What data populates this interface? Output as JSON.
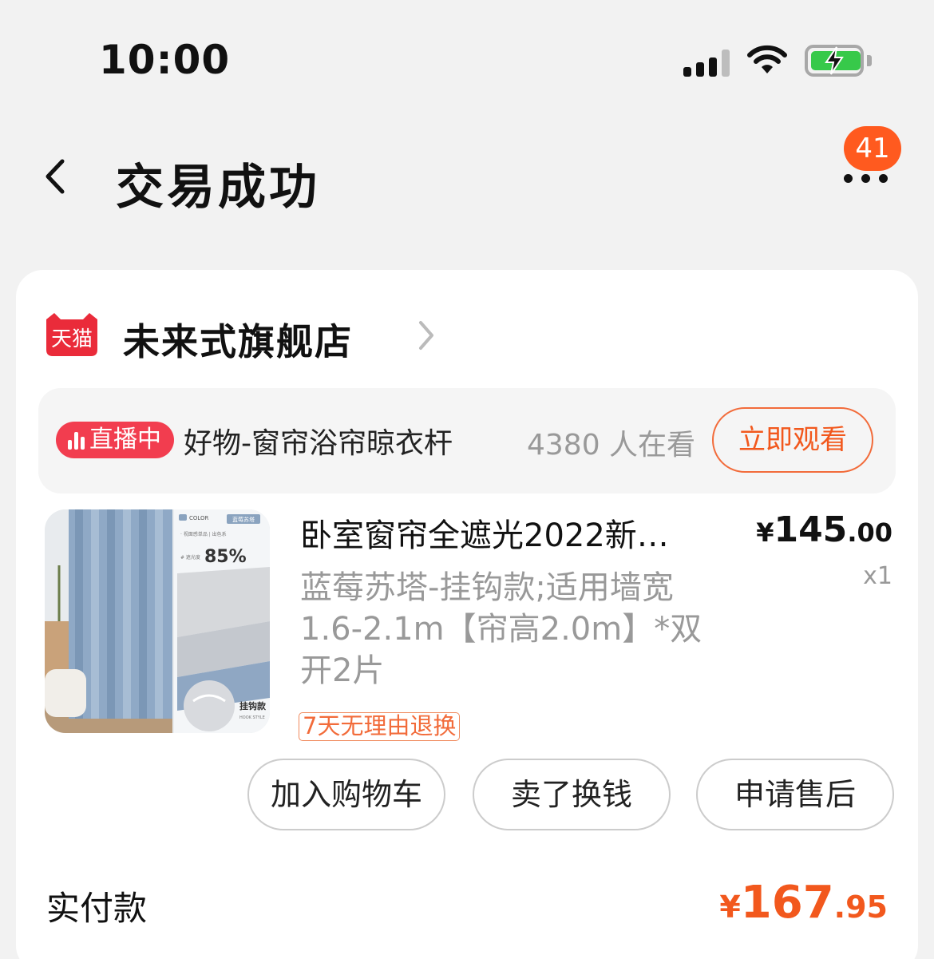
{
  "status_bar": {
    "time": "10:00"
  },
  "header": {
    "title": "交易成功",
    "message_badge": "41"
  },
  "store": {
    "logo_text": "天猫",
    "name": "未来式旗舰店"
  },
  "live": {
    "tag": "直播中",
    "title": "好物-窗帘浴帘晾衣杆",
    "viewers": "4380 人在看",
    "watch_label": "立即观看"
  },
  "product": {
    "image_texts": {
      "color": "COLOR",
      "tag": "蓝莓苏塔",
      "line1": "· 视面感单品 | 出色系",
      "shade_label": "# 遮光度",
      "shade_value": "85%",
      "hook_label": "挂钩款",
      "hook_sub": "HOOK STYLE"
    },
    "title": "卧室窗帘全遮光2022新…",
    "spec": "蓝莓苏塔-挂钩款;适用墙宽1.6-2.1m【帘高2.0m】*双开2片",
    "return_policy": "7天无理由退换",
    "price_currency": "¥",
    "price_int": "145",
    "price_dec": ".00",
    "quantity": "x1"
  },
  "actions": {
    "add_cart": "加入购物车",
    "sell": "卖了换钱",
    "after_sale": "申请售后"
  },
  "payment": {
    "label": "实付款",
    "currency": "¥",
    "amount_int": "167",
    "amount_dec": ".95"
  },
  "colors": {
    "accent": "#f2581d",
    "live_red": "#f23d4f",
    "badge": "#ff5a1f",
    "battery_green": "#37c94a"
  }
}
